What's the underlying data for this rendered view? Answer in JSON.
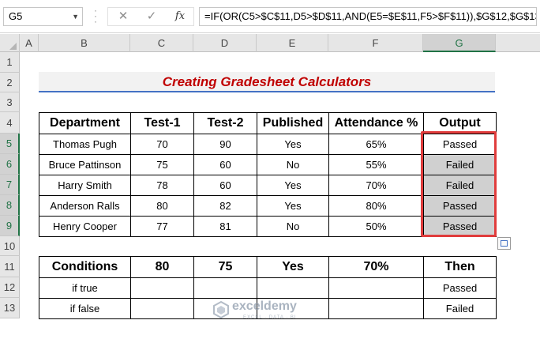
{
  "formula_bar": {
    "name_box": "G5",
    "cancel_icon": "✕",
    "enter_icon": "✓",
    "fx_label": "fx",
    "formula": "=IF(OR(C5>$C$11,D5>$D$11,AND(E5=$E$11,F5>$F$11)),$G$12,$G$13)"
  },
  "columns": [
    "A",
    "B",
    "C",
    "D",
    "E",
    "F",
    "G"
  ],
  "selected_column": "G",
  "rows": [
    "1",
    "2",
    "3",
    "4",
    "5",
    "6",
    "7",
    "8",
    "9",
    "10",
    "11",
    "12",
    "13"
  ],
  "selected_rows": [
    "5",
    "6",
    "7",
    "8",
    "9"
  ],
  "title": "Creating Gradesheet Calculators",
  "main_table": {
    "headers": [
      "Department",
      "Test-1",
      "Test-2",
      "Published",
      "Attendance %",
      "Output"
    ],
    "rows": [
      [
        "Thomas Pugh",
        "70",
        "90",
        "Yes",
        "65%",
        "Passed"
      ],
      [
        "Bruce Pattinson",
        "75",
        "60",
        "No",
        "55%",
        "Failed"
      ],
      [
        "Harry Smith",
        "78",
        "60",
        "Yes",
        "70%",
        "Failed"
      ],
      [
        "Anderson Ralls",
        "80",
        "82",
        "Yes",
        "80%",
        "Passed"
      ],
      [
        "Henry Cooper",
        "77",
        "81",
        "No",
        "50%",
        "Passed"
      ]
    ]
  },
  "conditions_table": {
    "headers": [
      "Conditions",
      "80",
      "75",
      "Yes",
      "70%",
      "Then"
    ],
    "rows": [
      [
        "if true",
        "",
        "",
        "",
        "",
        "Passed"
      ],
      [
        "if false",
        "",
        "",
        "",
        "",
        "Failed"
      ]
    ]
  },
  "watermark": {
    "name": "exceldemy",
    "tagline": "EXCEL · DATA · BI"
  },
  "colors": {
    "title_text": "#c00000",
    "title_underline": "#4472c4",
    "selection_border": "#e03c3c",
    "output_fill": "#d0d0d0",
    "excel_green": "#217346"
  }
}
